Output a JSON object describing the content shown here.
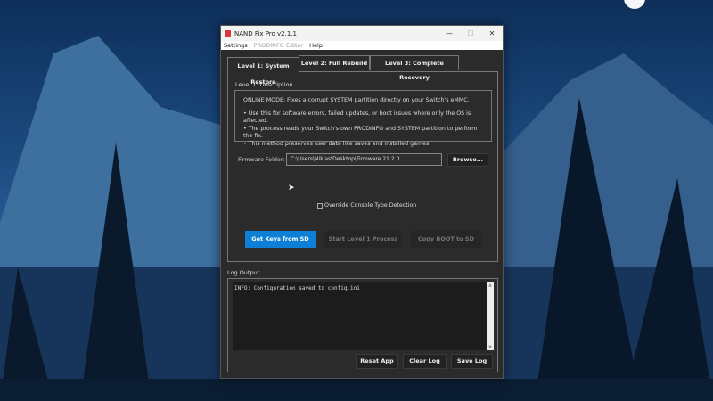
{
  "window": {
    "title": "NAND Fix Pro v2.1.1",
    "minimize": "—",
    "maximize": "☐",
    "close": "✕"
  },
  "menu": [
    "Settings",
    "PRODINFO Editor",
    "Help"
  ],
  "tabs": [
    {
      "label": "Level 1: System Restore",
      "active": true
    },
    {
      "label": "Level 2: Full Rebuild"
    },
    {
      "label": "Level 3: Complete Recovery"
    }
  ],
  "description": {
    "title": "Level 1: Description",
    "heading": "ONLINE MODE: Fixes a corrupt SYSTEM partition directly on your Switch's eMMC.",
    "bullets": [
      "• Use this for software errors, failed updates, or boot issues where only the OS is affected.",
      "• The process reads your Switch's own PRODINFO and SYSTEM partition to perform the fix.",
      "• This method preserves user data like saves and installed games."
    ]
  },
  "firmware": {
    "label": "Firmware Folder:",
    "value": "C:\\Users\\Niklas\\Desktop\\Firmware.21.2.0",
    "browse": "Browse..."
  },
  "override": {
    "label": "Override Console Type Detection",
    "checked": false
  },
  "actions": {
    "get_keys": "Get Keys from SD",
    "start": "Start Level 1 Process",
    "copy_boot": "Copy BOOT to SD"
  },
  "log": {
    "title": "Log Output",
    "lines": [
      "INFO: Configuration saved to config.ini"
    ],
    "reset": "Reset App",
    "clear": "Clear Log",
    "save": "Save Log"
  },
  "colors": {
    "accent": "#0e7fd6",
    "window_bg": "#2b2b2b"
  }
}
